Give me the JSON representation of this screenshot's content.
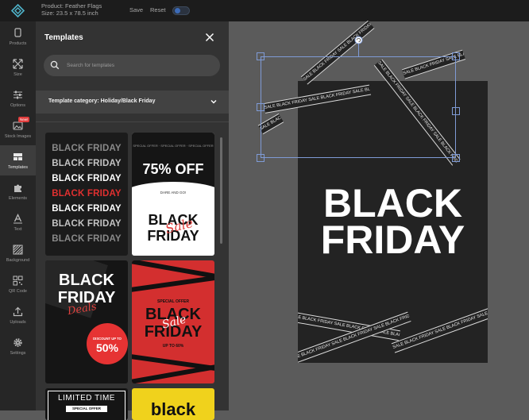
{
  "topbar": {
    "product": "Product: Feather Flags",
    "size": "Size: 23.5 x 78.5 inch",
    "save_label": "Save",
    "reset_label": "Reset"
  },
  "nav": {
    "items": [
      {
        "label": "Products",
        "icon": "product-icon"
      },
      {
        "label": "Size",
        "icon": "resize-icon"
      },
      {
        "label": "Options",
        "icon": "sliders-icon"
      },
      {
        "label": "Stock Images",
        "icon": "image-icon",
        "badge": "New!"
      },
      {
        "label": "Templates",
        "icon": "templates-icon",
        "active": true
      },
      {
        "label": "Elements",
        "icon": "puzzle-icon"
      },
      {
        "label": "Text",
        "icon": "text-icon"
      },
      {
        "label": "Background",
        "icon": "background-icon"
      },
      {
        "label": "QR Code",
        "icon": "qr-icon"
      },
      {
        "label": "Uploads",
        "icon": "upload-icon"
      },
      {
        "label": "Settings",
        "icon": "gear-icon"
      }
    ]
  },
  "panel": {
    "title": "Templates",
    "search_placeholder": "Search for templates",
    "category": "Template category: Holiday/Black Friday"
  },
  "templates": {
    "t1": {
      "lines": [
        {
          "text": "BLACK FRIDAY",
          "color": "#8a8a8a"
        },
        {
          "text": "BLACK FRIDAY",
          "color": "#c4c4c4"
        },
        {
          "text": "BLACK FRIDAY",
          "color": "#ffffff"
        },
        {
          "text": "BLACK FRIDAY",
          "color": "#e03030"
        },
        {
          "text": "BLACK FRIDAY",
          "color": "#ffffff"
        },
        {
          "text": "BLACK FRIDAY",
          "color": "#c4c4c4"
        },
        {
          "text": "BLACK FRIDAY",
          "color": "#8a8a8a"
        }
      ]
    },
    "t2": {
      "ticker": "SPECIAL OFFER · SPECIAL OFFER · SPECIAL OFFER",
      "headline": "75% OFF",
      "dare": "DARE AND GO!",
      "line1": "BLACK",
      "line2": "FRIDAY",
      "script": "Sale"
    },
    "t3": {
      "line1": "BLACK",
      "line2": "FRIDAY",
      "script": "Deals",
      "discount_label": "DISCOUNT UP TO",
      "discount_value": "50%"
    },
    "t4": {
      "special": "SPECIAL OFFER",
      "line1": "BLACK",
      "line2": "FRIDAY",
      "script": "Sale",
      "upto": "UP TO 60%"
    },
    "t5": {
      "headline": "LIMITED TIME",
      "sub": "SPECIAL OFFER"
    },
    "t6": {
      "word": "black"
    }
  },
  "canvas": {
    "line1": "BLACK",
    "line2": "FRIDAY",
    "tape_text": "SALE  BLACK FRIDAY SALE  BLACK FRIDAY SALE  BLACK FRIDAY SALE  BLACK FRIDAY SALE  BLACK FRIDAY SALE  BLACK FRIDAY SALE  BLACK FRIDAY SALE"
  }
}
